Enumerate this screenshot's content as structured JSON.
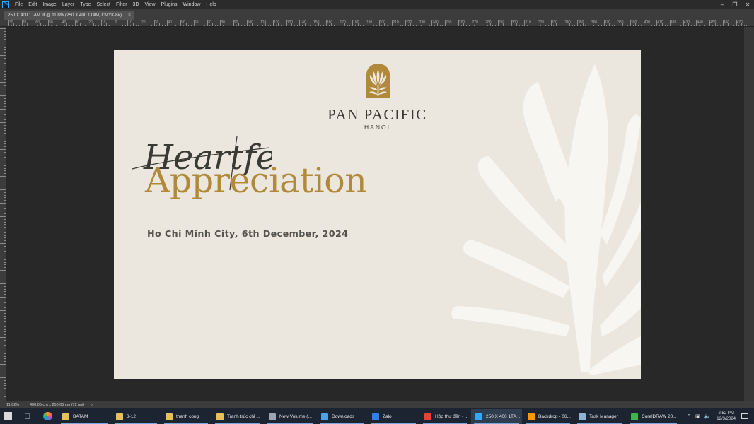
{
  "menubar": {
    "app_icon": "Ps",
    "items": [
      "File",
      "Edit",
      "Image",
      "Layer",
      "Type",
      "Select",
      "Filter",
      "3D",
      "View",
      "Plugins",
      "Window",
      "Help"
    ]
  },
  "document_tab": {
    "title": "250 X 400 1TAM.tif @ 11.8% (250 X 400 1TAM, CMYK/8#)",
    "close": "×"
  },
  "ruler": {
    "h_labels": [
      "30",
      "70",
      "60",
      "50",
      "40",
      "30",
      "20",
      "10",
      "0",
      "10",
      "20",
      "30",
      "40",
      "50",
      "60",
      "70",
      "80",
      "90",
      "100",
      "110",
      "120",
      "130",
      "140",
      "150",
      "160",
      "170",
      "180",
      "190",
      "200",
      "210",
      "220",
      "230",
      "240",
      "250",
      "260",
      "270",
      "280",
      "290",
      "300",
      "310",
      "320",
      "330",
      "340",
      "350",
      "360",
      "370",
      "380",
      "390",
      "400",
      "410",
      "420",
      "430",
      "440",
      "450",
      "460",
      "470"
    ]
  },
  "artwork": {
    "brand_name": "PAN PACIFIC",
    "brand_sub": "HANOI",
    "script_word": "Heartfelt",
    "headline": "Appreciation",
    "event_line": "Ho Chi Minh City, 6th December, 2024",
    "accent_color": "#b0893a",
    "background_color": "#ebe7de"
  },
  "statusbar": {
    "zoom": "11.82%",
    "doc_info": "400.05 cm x 250.05 cm (72 ppi)",
    "arrow": ">"
  },
  "taskbar": {
    "items": [
      {
        "label": "BATAM",
        "icon": "folder-icon",
        "color": "#e8c05a"
      },
      {
        "label": "3-12",
        "icon": "folder-icon",
        "color": "#e8c05a"
      },
      {
        "label": "thanh cong",
        "icon": "folder-icon",
        "color": "#e8c05a"
      },
      {
        "label": "Tranh trúc chỉ ...",
        "icon": "folder-icon",
        "color": "#e8c05a"
      },
      {
        "label": "New Volume (...",
        "icon": "drive-icon",
        "color": "#9aa6b2"
      },
      {
        "label": "Downloads",
        "icon": "download-icon",
        "color": "#4aa3e8"
      },
      {
        "label": "Zalo",
        "icon": "zalo-icon",
        "color": "#2f7ff0"
      },
      {
        "label": "Hộp thư đến - ...",
        "icon": "chrome-icon",
        "color": "#e94235"
      },
      {
        "label": "250 X 400 1TA...",
        "icon": "photoshop-icon",
        "color": "#31a8ff"
      },
      {
        "label": "Backdrop - 06...",
        "icon": "illustrator-icon",
        "color": "#ff9a00"
      },
      {
        "label": "Task Manager",
        "icon": "task-manager-icon",
        "color": "#8fb3d6"
      },
      {
        "label": "CorelDRAW 20...",
        "icon": "coreldraw-icon",
        "color": "#3cb54a"
      }
    ],
    "clock_time": "2:52 PM",
    "clock_date": "12/3/2024"
  }
}
